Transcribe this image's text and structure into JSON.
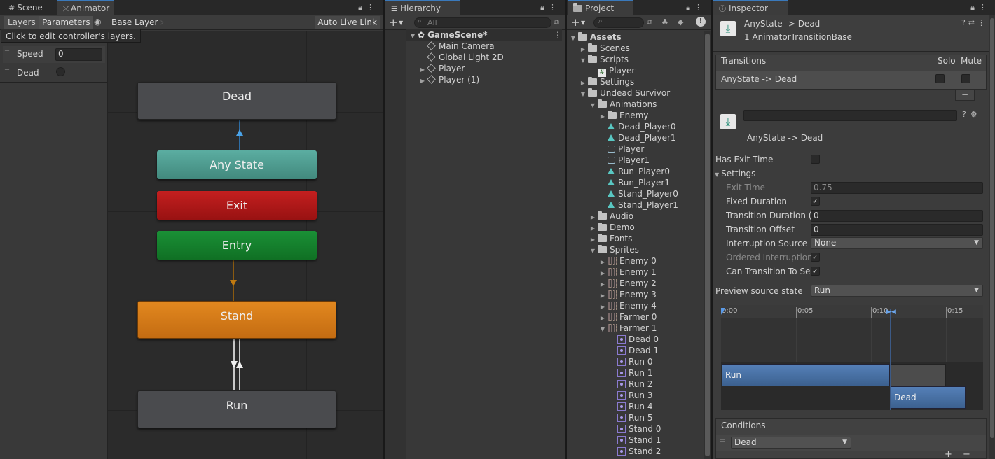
{
  "animator": {
    "tabs": [
      {
        "label": "Scene",
        "icon": "hash-icon"
      },
      {
        "label": "Animator",
        "icon": "animator-icon"
      }
    ],
    "toolbar": {
      "layers": "Layers",
      "parameters": "Parameters",
      "breadcrumb": "Base Layer",
      "live_link": "Auto Live Link"
    },
    "tooltip": "Click to edit controller's layers.",
    "params": [
      {
        "name": "Speed",
        "value": "0",
        "type": "float"
      },
      {
        "name": "Dead",
        "value": "",
        "type": "bool"
      }
    ],
    "nodes": {
      "dead": "Dead",
      "any_state": "Any State",
      "exit": "Exit",
      "entry": "Entry",
      "stand": "Stand",
      "run": "Run"
    },
    "colors": {
      "default_state": "#4a4a4a",
      "any_state": "#4e9a8c",
      "exit": "#b21818",
      "entry": "#16802c",
      "stand": "#d97a1c",
      "transition_selected": "#4aa3e8"
    }
  },
  "hierarchy": {
    "tab": "Hierarchy",
    "search_placeholder": "All",
    "items": [
      {
        "label": "GameScene*",
        "depth": 0,
        "expanded": true,
        "icon": "unity-scene-icon"
      },
      {
        "label": "Main Camera",
        "depth": 1,
        "icon": "gameobject-icon"
      },
      {
        "label": "Global Light 2D",
        "depth": 1,
        "icon": "gameobject-icon"
      },
      {
        "label": "Player",
        "depth": 1,
        "collapsed": true,
        "icon": "gameobject-icon"
      },
      {
        "label": "Player (1)",
        "depth": 1,
        "collapsed": true,
        "icon": "gameobject-icon"
      }
    ]
  },
  "project": {
    "tab": "Project",
    "items": [
      {
        "label": "Assets",
        "depth": 0,
        "type": "folder",
        "state": "open"
      },
      {
        "label": "Scenes",
        "depth": 1,
        "type": "folder",
        "state": "closed"
      },
      {
        "label": "Scripts",
        "depth": 1,
        "type": "folder",
        "state": "open"
      },
      {
        "label": "Player",
        "depth": 2,
        "type": "script"
      },
      {
        "label": "Settings",
        "depth": 1,
        "type": "folder",
        "state": "closed"
      },
      {
        "label": "Undead Survivor",
        "depth": 1,
        "type": "folder",
        "state": "open"
      },
      {
        "label": "Animations",
        "depth": 2,
        "type": "folder",
        "state": "open"
      },
      {
        "label": "Enemy",
        "depth": 3,
        "type": "folder",
        "state": "closed"
      },
      {
        "label": "Dead_Player0",
        "depth": 3,
        "type": "anim"
      },
      {
        "label": "Dead_Player1",
        "depth": 3,
        "type": "anim"
      },
      {
        "label": "Player",
        "depth": 3,
        "type": "controller"
      },
      {
        "label": "Player1",
        "depth": 3,
        "type": "controller"
      },
      {
        "label": "Run_Player0",
        "depth": 3,
        "type": "anim"
      },
      {
        "label": "Run_Player1",
        "depth": 3,
        "type": "anim"
      },
      {
        "label": "Stand_Player0",
        "depth": 3,
        "type": "anim"
      },
      {
        "label": "Stand_Player1",
        "depth": 3,
        "type": "anim"
      },
      {
        "label": "Audio",
        "depth": 2,
        "type": "folder",
        "state": "closed"
      },
      {
        "label": "Demo",
        "depth": 2,
        "type": "folder",
        "state": "closed"
      },
      {
        "label": "Fonts",
        "depth": 2,
        "type": "folder",
        "state": "closed"
      },
      {
        "label": "Sprites",
        "depth": 2,
        "type": "folder",
        "state": "open"
      },
      {
        "label": "Enemy 0",
        "depth": 3,
        "type": "sprite",
        "state": "closed"
      },
      {
        "label": "Enemy 1",
        "depth": 3,
        "type": "sprite",
        "state": "closed"
      },
      {
        "label": "Enemy 2",
        "depth": 3,
        "type": "sprite",
        "state": "closed"
      },
      {
        "label": "Enemy 3",
        "depth": 3,
        "type": "sprite",
        "state": "closed"
      },
      {
        "label": "Enemy 4",
        "depth": 3,
        "type": "sprite",
        "state": "closed"
      },
      {
        "label": "Farmer 0",
        "depth": 3,
        "type": "sprite",
        "state": "closed"
      },
      {
        "label": "Farmer 1",
        "depth": 3,
        "type": "sprite",
        "state": "open"
      },
      {
        "label": "Dead 0",
        "depth": 4,
        "type": "subsprite"
      },
      {
        "label": "Dead 1",
        "depth": 4,
        "type": "subsprite"
      },
      {
        "label": "Run 0",
        "depth": 4,
        "type": "subsprite"
      },
      {
        "label": "Run 1",
        "depth": 4,
        "type": "subsprite"
      },
      {
        "label": "Run 2",
        "depth": 4,
        "type": "subsprite"
      },
      {
        "label": "Run 3",
        "depth": 4,
        "type": "subsprite"
      },
      {
        "label": "Run 4",
        "depth": 4,
        "type": "subsprite"
      },
      {
        "label": "Run 5",
        "depth": 4,
        "type": "subsprite"
      },
      {
        "label": "Stand 0",
        "depth": 4,
        "type": "subsprite"
      },
      {
        "label": "Stand 1",
        "depth": 4,
        "type": "subsprite"
      },
      {
        "label": "Stand 2",
        "depth": 4,
        "type": "subsprite"
      }
    ]
  },
  "inspector": {
    "tab": "Inspector",
    "title": "AnyState -> Dead",
    "subtitle": "1 AnimatorTransitionBase",
    "transitions_header": "Transitions",
    "solo": "Solo",
    "mute": "Mute",
    "transition_item": "AnyState -> Dead",
    "remove_btn": "−",
    "detail_title": "AnyState -> Dead",
    "has_exit_time_label": "Has Exit Time",
    "settings_label": "Settings",
    "fields": {
      "exit_time": {
        "label": "Exit Time",
        "value": "0.75"
      },
      "fixed_duration": {
        "label": "Fixed Duration"
      },
      "transition_duration": {
        "label": "Transition Duration (s",
        "value": "0"
      },
      "transition_offset": {
        "label": "Transition Offset",
        "value": "0"
      },
      "interruption_source": {
        "label": "Interruption Source",
        "value": "None"
      },
      "ordered_interruption": {
        "label": "Ordered Interruption"
      },
      "can_transition": {
        "label": "Can Transition To Se"
      }
    },
    "preview_label": "Preview source state",
    "preview_value": "Run",
    "timeline": {
      "ticks": [
        "0:00",
        "0:05",
        "0:10",
        "0:15"
      ],
      "source_bar": "Run",
      "dest_bar": "Dead"
    },
    "conditions_header": "Conditions",
    "condition_value": "Dead"
  }
}
